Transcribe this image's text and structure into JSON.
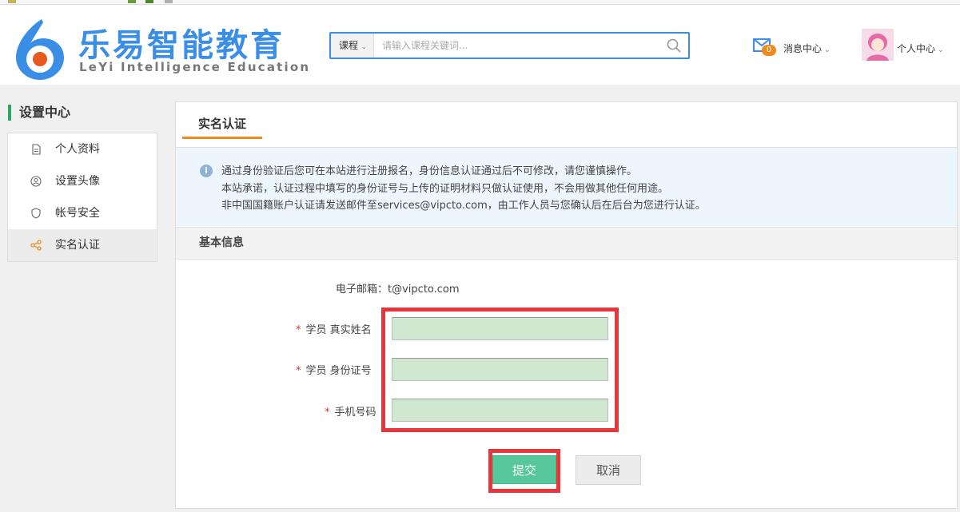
{
  "header": {
    "logo_title": "乐易智能教育",
    "logo_subtitle": "LeYi Intelligence Education",
    "search": {
      "category": "课程",
      "placeholder": "请输入课程关键词..."
    },
    "messages": {
      "label": "消息中心",
      "count": "0"
    },
    "user_menu": {
      "label": "个人中心"
    }
  },
  "sidebar": {
    "title": "设置中心",
    "items": [
      {
        "label": "个人资料",
        "icon": "document-icon"
      },
      {
        "label": "设置头像",
        "icon": "avatar-icon"
      },
      {
        "label": "帐号安全",
        "icon": "shield-icon"
      },
      {
        "label": "实名认证",
        "icon": "share-icon",
        "active": true
      }
    ]
  },
  "main": {
    "tab": "实名认证",
    "notice": {
      "line1": "通过身份验证后您可在本站进行注册报名，身份信息认证通过后不可修改，请您谨慎操作。",
      "line2": "本站承诺，认证过程中填写的身份证号与上传的证明材料只做认证使用，不会用做其他任何用途。",
      "line3": "非中国国籍账户认证请发送邮件至services@vipcto.com，由工作人员与您确认后在后台为您进行认证。"
    },
    "section_title": "基本信息",
    "form": {
      "email_label": "电子邮箱：",
      "email_value": "t@vipcto.com",
      "required_mark": "*",
      "name_label": "学员 真实姓名",
      "name_value": "",
      "id_label": "学员 身份证号",
      "id_value": "",
      "phone_label": "手机号码",
      "phone_value": "",
      "submit_label": "提交",
      "cancel_label": "取消"
    }
  },
  "colors": {
    "brand_blue": "#3a8ee6",
    "accent_orange": "#f08a1c",
    "sidebar_green": "#2aa861",
    "submit_green": "#56c79a",
    "highlight_red": "#e8343b",
    "input_green": "#cfe8cf"
  }
}
